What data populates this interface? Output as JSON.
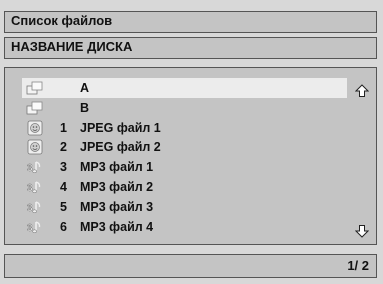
{
  "window": {
    "title": "Список файлов"
  },
  "disc": {
    "name": "НАЗВАНИЕ ДИСКА"
  },
  "files": [
    {
      "number": "",
      "name": "A",
      "icon": "folder-icon",
      "selected": true
    },
    {
      "number": "",
      "name": "B",
      "icon": "folder-icon",
      "selected": false
    },
    {
      "number": "1",
      "name": "JPEG файл 1",
      "icon": "image-file-icon",
      "selected": false
    },
    {
      "number": "2",
      "name": "JPEG файл 2",
      "icon": "image-file-icon",
      "selected": false
    },
    {
      "number": "3",
      "name": "MP3 файл 1",
      "icon": "music-file-icon",
      "selected": false
    },
    {
      "number": "4",
      "name": "MP3 файл 2",
      "icon": "music-file-icon",
      "selected": false
    },
    {
      "number": "5",
      "name": "MP3 файл 3",
      "icon": "music-file-icon",
      "selected": false
    },
    {
      "number": "6",
      "name": "MP3 файл 4",
      "icon": "music-file-icon",
      "selected": false
    }
  ],
  "pager": {
    "text": "1/ 2"
  },
  "icons": {
    "scroll_up": "arrow-up-icon",
    "scroll_down": "arrow-down-icon"
  }
}
